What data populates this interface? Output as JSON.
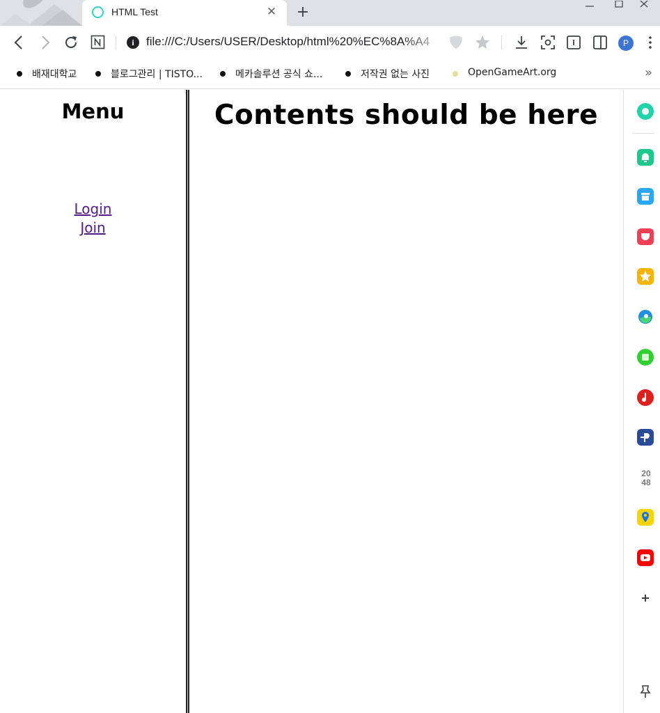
{
  "browser": {
    "tab": {
      "title": "HTML Test"
    },
    "address_bar": {
      "url": "file:///C:/Users/USER/Desktop/html%20%EC%8A%A4"
    },
    "profile_initial": "P",
    "bookmarks": [
      {
        "label": "배재대학교",
        "dot_color": "#555555"
      },
      {
        "label": "블로그관리 | TISTO...",
        "dot_color": "#111111"
      },
      {
        "label": "메카솔루션 공식 쇼...",
        "dot_color": "#111111"
      },
      {
        "label": "저작권 없는 사진",
        "dot_color": "#111111"
      },
      {
        "label": "OpenGameArt.org",
        "dot_color": "#e8dca0"
      }
    ],
    "bookmarks_more": "»"
  },
  "page": {
    "menu": {
      "title": "Menu",
      "links": [
        {
          "label": "Login"
        },
        {
          "label": "Join"
        }
      ]
    },
    "content": {
      "title": "Contents should be here"
    }
  },
  "side_panel": {
    "items": [
      {
        "icon": "circle-app-icon",
        "color": "#1ed4a8"
      },
      {
        "icon": "bell-app-icon",
        "color": "#1dc98a"
      },
      {
        "icon": "archive-app-icon",
        "color": "#2aa7f2"
      },
      {
        "icon": "pocket-app-icon",
        "color": "#ef4056"
      },
      {
        "icon": "star-app-icon",
        "color": "#f5b400"
      },
      {
        "icon": "edge-app-icon",
        "color": "#1f8fe0"
      },
      {
        "icon": "square-app-icon",
        "color": "#2fd12f"
      },
      {
        "icon": "music-note-app-icon",
        "color": "#e0201c"
      },
      {
        "icon": "plus-p-app-icon",
        "color": "#2b4a9a"
      },
      {
        "icon": "2048-app-icon",
        "color": "#777777",
        "text": "2048"
      },
      {
        "icon": "map-pin-app-icon",
        "color": "#f6d400"
      },
      {
        "icon": "youtube-app-icon",
        "color": "#ff0000"
      }
    ]
  }
}
